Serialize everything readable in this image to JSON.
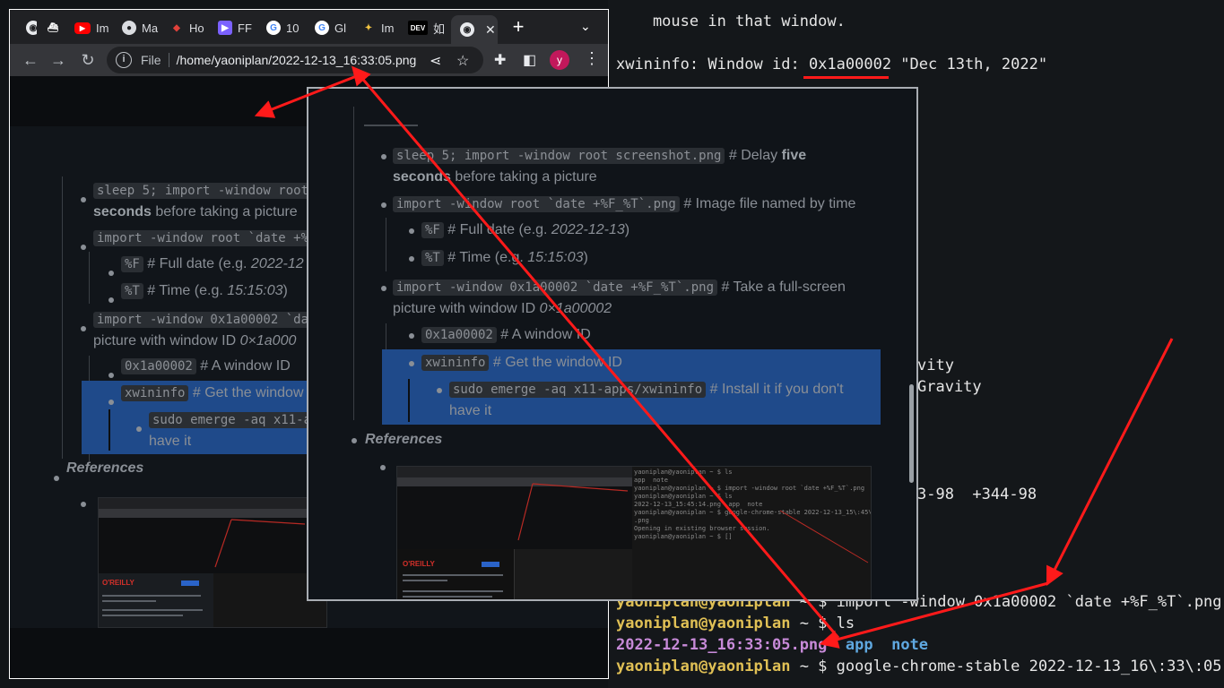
{
  "browser": {
    "tabs": [
      {
        "label": "",
        "icon": "globe-icon"
      },
      {
        "label": "",
        "icon": "docker-icon"
      },
      {
        "label": "Im",
        "icon": "youtube-icon"
      },
      {
        "label": "Ma",
        "icon": "github-icon"
      },
      {
        "label": "Ho",
        "icon": "ruby-icon"
      },
      {
        "label": "FF",
        "icon": "ffmpeg-icon"
      },
      {
        "label": "10",
        "icon": "google-icon"
      },
      {
        "label": "Gl",
        "icon": "google-icon"
      },
      {
        "label": "Im",
        "icon": "magic-wand-icon"
      },
      {
        "label": "如",
        "icon": "dev-icon",
        "badge": "DEV"
      },
      {
        "label": "",
        "icon": "globe-icon",
        "active": true
      }
    ],
    "new_tab": "+",
    "omnibox": {
      "scheme_label": "File",
      "url": "/home/yaoniplan/2022-12-13_16:33:05.png"
    },
    "avatar_letter": "y"
  },
  "notes": {
    "item1_code": "sleep 5; import -window root screenshot.png",
    "item1_text_a": " # Delay ",
    "item1_bold": "five",
    "item1_bold2": "seconds",
    "item1_text_b": " before taking a picture",
    "item2_code": "import -window root `date +%F_%T`.png",
    "item2_text": " # Image file named by time",
    "sub1_code": "%F",
    "sub1_text": " # Full date (e.g. ",
    "sub1_ex": "2022-12-13",
    "sub2_code": "%T",
    "sub2_text": " # Time (e.g. ",
    "sub2_ex": "15:15:03",
    "close_paren": ")",
    "item3_code": "import -window 0x1a00002 `date +%F_%T`.png",
    "item3_text": " # Take a full-screen",
    "item3_text2": "picture with window ID ",
    "item3_id": "0×1a00002",
    "sub3_code": "0x1a00002",
    "sub3_text": " # A window ID",
    "sub4_code": "xwininfo",
    "sub4_text": " # Get the window ID",
    "sub5_code": "sudo emerge -aq x11-apps/xwininfo",
    "sub5_text": " # Install it if you don't",
    "sub5_text2": "have it",
    "references": "References",
    "left_item1_code": "sleep 5; import -window root",
    "left_item1_text": "seconds before taking a picture",
    "left_item2_code": "import -window root `date +%F",
    "left_sub1_text": " # Full date (e.g. ",
    "left_sub1_ex": "2022-12",
    "left_sub2_ex": "15:15:03",
    "left_item3_code": "import -window 0x1a00002 `dat",
    "left_item3_text": "picture with window ID ",
    "left_item3_id": "0×1a000",
    "left_sub4_text": " # Get the window",
    "left_sub5_code": "sudo emerge -aq x11-a",
    "left_sub5_text2": "have it"
  },
  "terminal": {
    "line_mouse": "    mouse in that window.",
    "line_xwininfo_prefix": "xwininfo: Window id: ",
    "line_xwininfo_id": "0x1a00002",
    "line_xwininfo_suffix": " \"Dec 13th, 2022\"",
    "frag_vity": "vity",
    "frag_gravity": "Gravity",
    "frag_geom": "3-98  +344-98",
    "prompt_user": "yaoniplan@yaoniplan",
    "prompt_tilde": " ~ $ ",
    "cmd_import": "import -window 0x1a00002 `date +%F_%T`.png",
    "cmd_ls": "ls",
    "ls_file": "2022-12-13_16:33:05.png",
    "ls_app": "app",
    "ls_note": "note",
    "cmd_chrome": "google-chrome-stable 2022-12-13_16\\:33\\:05"
  },
  "mini": {
    "oreilly": "O'REILLY",
    "term_lines": "yaoniplan@yaoniplan ~ $ ls\napp  note\nyaoniplan@yaoniplan ~ $ import -window root `date +%F_%T`.png\nyaoniplan@yaoniplan ~ $ ls\n2022-12-13_15:45:14.png  app  note\nyaoniplan@yaoniplan ~ $ google-chrome-stable 2022-12-13_15\\:45\\:14\n.png\nOpening in existing browser session.\nyaoniplan@yaoniplan ~ $ []"
  },
  "colors": {
    "annotation_red": "#ff1a1a",
    "selection_blue": "#1f4a8a",
    "prompt_yellow": "#e0c055",
    "file_purple": "#c78ad8",
    "dir_blue": "#5fa8e0"
  }
}
